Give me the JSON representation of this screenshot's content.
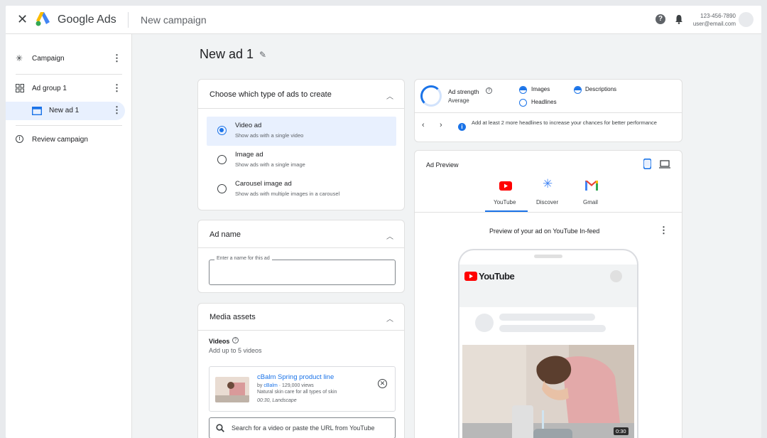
{
  "header": {
    "brand": "Google Ads",
    "breadcrumb": "New campaign",
    "help_glyph": "?",
    "phone": "123-456-7890",
    "email": "user@email.com"
  },
  "sidebar": {
    "campaign": "Campaign",
    "ad_group": "Ad group 1",
    "ad": "New ad 1",
    "review": "Review campaign"
  },
  "page": {
    "title": "New ad 1"
  },
  "ad_type": {
    "title": "Choose which type of ads to create",
    "selected": "Video ad",
    "options": [
      {
        "title": "Video ad",
        "subtitle": "Show ads with a single video"
      },
      {
        "title": "Image ad",
        "subtitle": "Show ads with a single image"
      },
      {
        "title": "Carousel image ad",
        "subtitle": "Show ads with multiple images in a carousel"
      }
    ]
  },
  "ad_name": {
    "title": "Ad name",
    "field_label": "Enter a name for this ad",
    "value": ""
  },
  "media": {
    "title": "Media assets",
    "videos_label": "Videos",
    "videos_hint": "Add up to 5 videos",
    "video": {
      "title": "cBalm Spring product line",
      "by": "by",
      "channel": "cBalm",
      "views": " · 129,000 views",
      "desc": "Natural skin care for all types of skin",
      "meta": "00:30, Landscape"
    },
    "search_placeholder": "Search for a video or paste the URL from YouTube"
  },
  "strength": {
    "title": "Ad strength",
    "level": "Average",
    "items": [
      "Images",
      "Descriptions",
      "Headlines"
    ],
    "tip": "Add at least 2 more headlines to increase your chances for better performance"
  },
  "preview": {
    "title": "Ad Preview",
    "tabs": [
      "YouTube",
      "Discover",
      "Gmail"
    ],
    "active_tab": "YouTube",
    "caption": "Preview of your ad on YouTube In-feed",
    "yt_logo": "YouTube",
    "duration": "0:30"
  },
  "colors": {
    "accent": "#1a73e8",
    "youtube_red": "#ff0000",
    "selected_bg": "#e8f0fe"
  }
}
